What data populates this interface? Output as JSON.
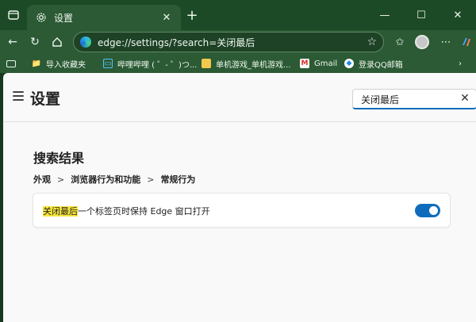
{
  "tab": {
    "title": "设置",
    "icon": "gear-icon"
  },
  "address": {
    "url": "edge://settings/?search=关闭最后"
  },
  "bookmarks": [
    {
      "label": "导入收藏夹",
      "icon": "folder-import-icon"
    },
    {
      "label": "哔哩哔哩 ( ゜- ゜)つ...",
      "icon": "bilibili-icon"
    },
    {
      "label": "单机游戏_单机游戏...",
      "icon": "folder-icon"
    },
    {
      "label": "Gmail",
      "icon": "gmail-icon"
    },
    {
      "label": "登录QQ邮箱",
      "icon": "qq-mail-icon"
    }
  ],
  "settings": {
    "title": "设置",
    "search_value": "关闭最后",
    "results_title": "搜索结果",
    "breadcrumb": [
      "外观",
      "浏览器行为和功能",
      "常规行为"
    ],
    "breadcrumb_sep": ">",
    "result": {
      "highlight": "关闭最后",
      "rest": "一个标签页时保持 Edge 窗口打开",
      "enabled": true
    }
  },
  "colors": {
    "accent": "#0f6cbd",
    "frame": "#2b5a34",
    "highlight": "#f7e53b"
  }
}
